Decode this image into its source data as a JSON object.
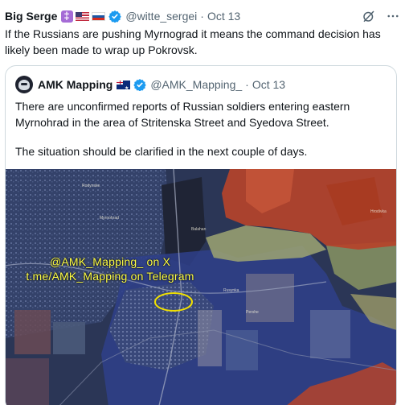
{
  "tweet": {
    "author": "Big Serge",
    "handle": "@witte_sergei",
    "separator": "·",
    "time": "Oct 13",
    "text": "If the Russians are pushing Myrnograd it means the command decision has likely been made to wrap up Pokrovsk.",
    "icons": [
      "purple-badge-icon",
      "us-flag-icon",
      "russia-flag-icon",
      "verified-icon",
      "grok-icon",
      "more-icon"
    ]
  },
  "quoted": {
    "author": "AMK Mapping",
    "handle": "@AMK_Mapping_",
    "separator": "·",
    "time": "Oct 13",
    "paragraph1": "There are unconfirmed reports of Russian soldiers entering eastern Myrnohrad in the area of Stritenska Street and Syedova Street.",
    "paragraph2": "The situation should be clarified in the next couple of days.",
    "icons": [
      "avatar",
      "australia-flag-icon",
      "verified-icon"
    ]
  },
  "map": {
    "watermark_line1": "@AMK_Mapping_ on X",
    "watermark_line2": "t.me/AMK_Mapping on Telegram",
    "watermark_color": "#ffff4a",
    "zone_colors": {
      "russian_controlled": "#b5432a",
      "ukrainian_controlled": "#2f3f8a",
      "highlight": "#f0e000"
    },
    "place_labels": [
      "Myrnohrad",
      "Rodynske",
      "Balahan",
      "Pershe",
      "Rusynka",
      "Hrodivka"
    ]
  },
  "colors": {
    "text": "#0f1419",
    "secondary_text": "#536471",
    "border": "#cfd9de",
    "verified": "#1d9bf0"
  }
}
